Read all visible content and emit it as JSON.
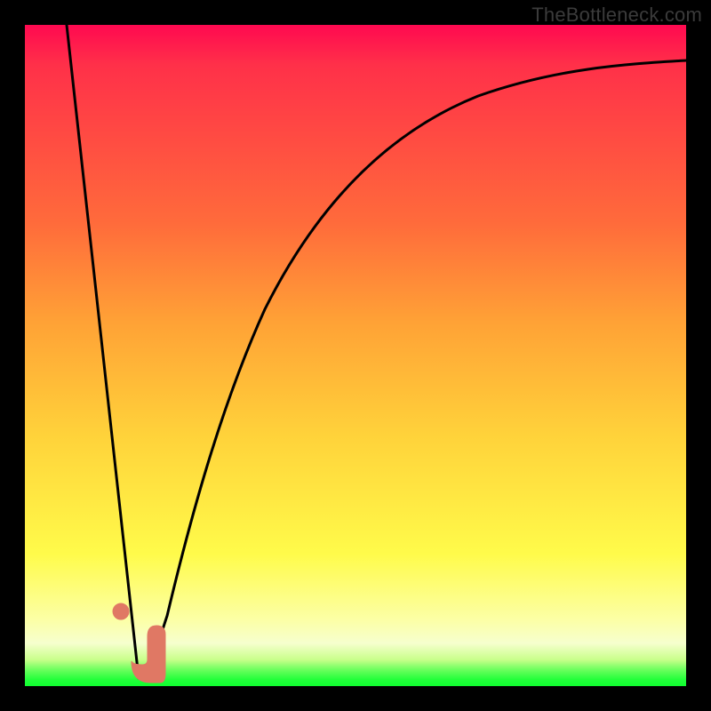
{
  "watermark": "TheBottleneck.com",
  "colors": {
    "frame": "#000000",
    "curve": "#000000",
    "marker": "#e07864",
    "gradient_top": "#ff0950",
    "gradient_mid": "#ffd23a",
    "gradient_bottom": "#0fff30"
  },
  "chart_data": {
    "type": "line",
    "title": "",
    "xlabel": "",
    "ylabel": "",
    "xlim": [
      0,
      100
    ],
    "ylim": [
      0,
      100
    ],
    "grid": false,
    "legend": false,
    "series": [
      {
        "name": "bottleneck-curve",
        "x": [
          0,
          5,
          10,
          14,
          16,
          18,
          20,
          25,
          30,
          35,
          40,
          50,
          60,
          70,
          80,
          90,
          100
        ],
        "y": [
          100,
          70,
          40,
          16,
          4,
          1,
          6,
          28,
          48,
          60,
          68,
          79,
          85,
          89,
          92,
          94,
          95
        ]
      }
    ],
    "annotations": [
      {
        "name": "marker-dot",
        "shape": "circle",
        "x": 14.5,
        "y": 11
      },
      {
        "name": "marker-elbow",
        "shape": "L",
        "x": 18.0,
        "y": 1
      }
    ]
  }
}
